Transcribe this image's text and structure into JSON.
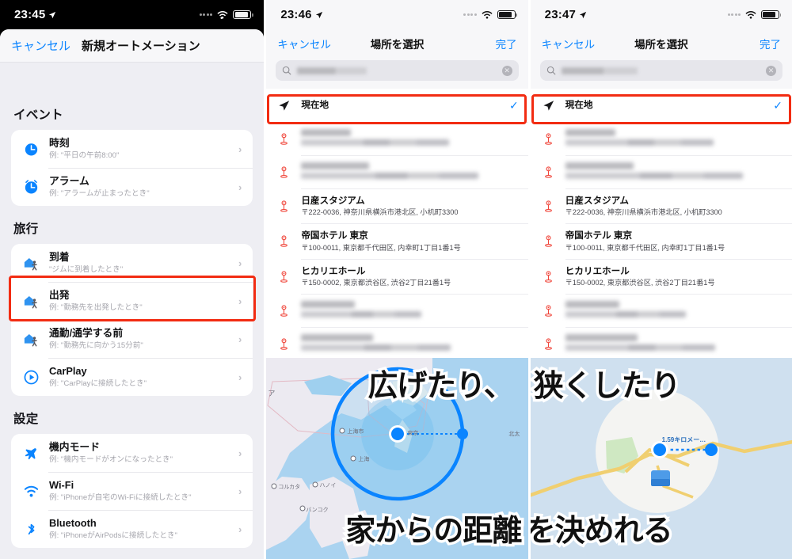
{
  "panels": {
    "left": {
      "status": {
        "time": "23:45",
        "location_arrow": "location-arrow-icon"
      },
      "nav": {
        "cancel": "キャンセル",
        "title": "新規オートメーション"
      },
      "sections": [
        {
          "header": "イベント",
          "items": [
            {
              "icon": "clock-icon",
              "title": "時刻",
              "sub": "例: \"平日の午前8:00\"",
              "chevron": "›",
              "highlighted": false
            },
            {
              "icon": "alarm-icon",
              "title": "アラーム",
              "sub": "例: \"アラームが止まったとき\"",
              "chevron": "›",
              "highlighted": false
            }
          ]
        },
        {
          "header": "旅行",
          "items": [
            {
              "icon": "home-walk-icon",
              "title": "到着",
              "sub": "\"ジムに到着したとき\"",
              "chevron": "›",
              "highlighted": false
            },
            {
              "icon": "home-walk-icon",
              "title": "出発",
              "sub": "例: \"勤務先を出発したとき\"",
              "chevron": "›",
              "highlighted": true
            },
            {
              "icon": "home-walk-icon",
              "title": "通勤/通学する前",
              "sub": "例: \"勤務先に向かう15分前\"",
              "chevron": "›",
              "highlighted": false
            },
            {
              "icon": "carplay-icon",
              "title": "CarPlay",
              "sub": "例: \"CarPlayに接続したとき\"",
              "chevron": "›",
              "highlighted": false
            }
          ]
        },
        {
          "header": "設定",
          "items": [
            {
              "icon": "airplane-icon",
              "title": "機内モード",
              "sub": "例: \"機内モードがオンになったとき\"",
              "chevron": "›",
              "highlighted": false
            },
            {
              "icon": "wifi-icon",
              "title": "Wi-Fi",
              "sub": "例: \"iPhoneが自宅のWi-Fiに接続したとき\"",
              "chevron": "›",
              "highlighted": false
            },
            {
              "icon": "bluetooth-icon",
              "title": "Bluetooth",
              "sub": "例: \"iPhoneがAirPodsに接続したとき\"",
              "chevron": "›",
              "highlighted": false
            }
          ]
        }
      ]
    },
    "mid": {
      "status": {
        "time": "23:46",
        "location_arrow": "location-arrow-icon"
      },
      "nav": {
        "cancel": "キャンセル",
        "title": "場所を選択",
        "done": "完了"
      },
      "search": {
        "icon": "search-icon",
        "value": "",
        "placeholder": "",
        "redacted": true,
        "clear": "✕"
      },
      "results": [
        {
          "icon": "location-arrow-icon",
          "title": "現在地",
          "sub": "",
          "check": "✓",
          "highlighted": true,
          "redacted": false
        },
        {
          "icon": "map-pin-icon",
          "title": "",
          "sub": "",
          "check": "",
          "highlighted": false,
          "redacted": true
        },
        {
          "icon": "map-pin-icon",
          "title": "",
          "sub": "",
          "check": "",
          "highlighted": false,
          "redacted": true
        },
        {
          "icon": "map-pin-icon",
          "title": "日産スタジアム",
          "sub": "〒222-0036, 神奈川県横浜市港北区, 小机町3300",
          "check": "",
          "highlighted": false,
          "redacted": false
        },
        {
          "icon": "map-pin-icon",
          "title": "帝国ホテル 東京",
          "sub": "〒100-0011, 東京都千代田区, 内幸町1丁目1番1号",
          "check": "",
          "highlighted": false,
          "redacted": false
        },
        {
          "icon": "map-pin-icon",
          "title": "ヒカリエホール",
          "sub": "〒150-0002, 東京都渋谷区, 渋谷2丁目21番1号",
          "check": "",
          "highlighted": false,
          "redacted": false
        },
        {
          "icon": "map-pin-icon",
          "title": "",
          "sub": "",
          "check": "",
          "highlighted": false,
          "redacted": true
        },
        {
          "icon": "map-pin-icon",
          "title": "",
          "sub": "",
          "check": "",
          "highlighted": false,
          "redacted": true
        }
      ],
      "map": {
        "overlay_top": "広げたり、",
        "overlay_bottom": "家からの距離",
        "labels": [
          "ア",
          "上海市",
          "上海",
          "東京",
          "コルカタ",
          "ハノイ",
          "バンコク",
          "北太"
        ],
        "radius_label": ""
      }
    },
    "right": {
      "status": {
        "time": "23:47",
        "location_arrow": "location-arrow-icon"
      },
      "nav": {
        "cancel": "キャンセル",
        "title": "場所を選択",
        "done": "完了"
      },
      "search": {
        "icon": "search-icon",
        "value": "",
        "placeholder": "",
        "redacted": true,
        "clear": "✕"
      },
      "results": [
        {
          "icon": "location-arrow-icon",
          "title": "現在地",
          "sub": "",
          "check": "✓",
          "highlighted": true,
          "redacted": false
        },
        {
          "icon": "map-pin-icon",
          "title": "",
          "sub": "",
          "check": "",
          "highlighted": false,
          "redacted": true
        },
        {
          "icon": "map-pin-icon",
          "title": "",
          "sub": "",
          "check": "",
          "highlighted": false,
          "redacted": true
        },
        {
          "icon": "map-pin-icon",
          "title": "日産スタジアム",
          "sub": "〒222-0036, 神奈川県横浜市港北区, 小机町3300",
          "check": "",
          "highlighted": false,
          "redacted": false
        },
        {
          "icon": "map-pin-icon",
          "title": "帝国ホテル 東京",
          "sub": "〒100-0011, 東京都千代田区, 内幸町1丁目1番1号",
          "check": "",
          "highlighted": false,
          "redacted": false
        },
        {
          "icon": "map-pin-icon",
          "title": "ヒカリエホール",
          "sub": "〒150-0002, 東京都渋谷区, 渋谷2丁目21番1号",
          "check": "",
          "highlighted": false,
          "redacted": false
        },
        {
          "icon": "map-pin-icon",
          "title": "",
          "sub": "",
          "check": "",
          "highlighted": false,
          "redacted": true
        },
        {
          "icon": "map-pin-icon",
          "title": "",
          "sub": "",
          "check": "",
          "highlighted": false,
          "redacted": true
        }
      ],
      "map": {
        "overlay_top": "狭くしたり",
        "overlay_bottom": "を決めれる",
        "labels": [],
        "radius_label": "1.59キロメー…"
      }
    }
  },
  "colors": {
    "accent_blue": "#0a84ff",
    "highlight_red": "#f22c12",
    "pin_red": "#f0453a",
    "sheet_bg": "#eeeef3",
    "map_sea": "#aad3f0",
    "map_land": "#eceaf1"
  }
}
